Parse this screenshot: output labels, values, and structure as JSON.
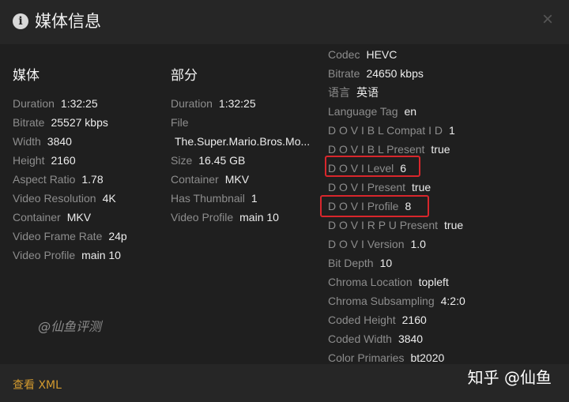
{
  "dialog": {
    "title": "媒体信息",
    "info_icon": "info-icon",
    "close_icon": "close-icon",
    "close_glyph": "×"
  },
  "columns": {
    "media": {
      "heading": "媒体",
      "rows": [
        {
          "k": "Duration",
          "v": "1:32:25"
        },
        {
          "k": "Bitrate",
          "v": "25527 kbps"
        },
        {
          "k": "Width",
          "v": "3840"
        },
        {
          "k": "Height",
          "v": "2160"
        },
        {
          "k": "Aspect Ratio",
          "v": "1.78"
        },
        {
          "k": "Video Resolution",
          "v": "4K"
        },
        {
          "k": "Container",
          "v": "MKV"
        },
        {
          "k": "Video Frame Rate",
          "v": "24p"
        },
        {
          "k": "Video Profile",
          "v": "main 10"
        }
      ]
    },
    "part": {
      "heading": "部分",
      "rows": [
        {
          "k": "Duration",
          "v": "1:32:25"
        },
        {
          "k": "File",
          "v": ""
        },
        {
          "k": "",
          "v": "The.Super.Mario.Bros.Mo..."
        },
        {
          "k": "Size",
          "v": "16.45 GB"
        },
        {
          "k": "Container",
          "v": "MKV"
        },
        {
          "k": "Has Thumbnail",
          "v": "1"
        },
        {
          "k": "Video Profile",
          "v": "main 10"
        }
      ]
    },
    "stream": {
      "rows": [
        {
          "k": "Codec",
          "v": "HEVC"
        },
        {
          "k": "Bitrate",
          "v": "24650 kbps"
        },
        {
          "k": "语言",
          "v": "英语"
        },
        {
          "k": "Language Tag",
          "v": "en"
        },
        {
          "k": "D O V I B L Compat I D",
          "v": "1"
        },
        {
          "k": "D O V I B L Present",
          "v": "true"
        },
        {
          "k": "D O V I Level",
          "v": "6"
        },
        {
          "k": "D O V I Present",
          "v": "true"
        },
        {
          "k": "D O V I Profile",
          "v": "8"
        },
        {
          "k": "D O V I R P U Present",
          "v": "true"
        },
        {
          "k": "D O V I Version",
          "v": "1.0"
        },
        {
          "k": "Bit Depth",
          "v": "10"
        },
        {
          "k": "Chroma Location",
          "v": "topleft"
        },
        {
          "k": "Chroma Subsampling",
          "v": "4:2:0"
        },
        {
          "k": "Coded Height",
          "v": "2160"
        },
        {
          "k": "Coded Width",
          "v": "3840"
        },
        {
          "k": "Color Primaries",
          "v": "bt2020"
        }
      ]
    }
  },
  "watermark": "@仙鱼评测",
  "footer": {
    "xml_link": "查看 XML",
    "zhihu_mark": "知乎 @仙鱼"
  },
  "colors": {
    "background": "#1f1f1f",
    "header": "#262626",
    "key_text": "#8d8d8d",
    "value_text": "#ededed",
    "link": "#d39a2f",
    "highlight_box": "#d8262c"
  }
}
